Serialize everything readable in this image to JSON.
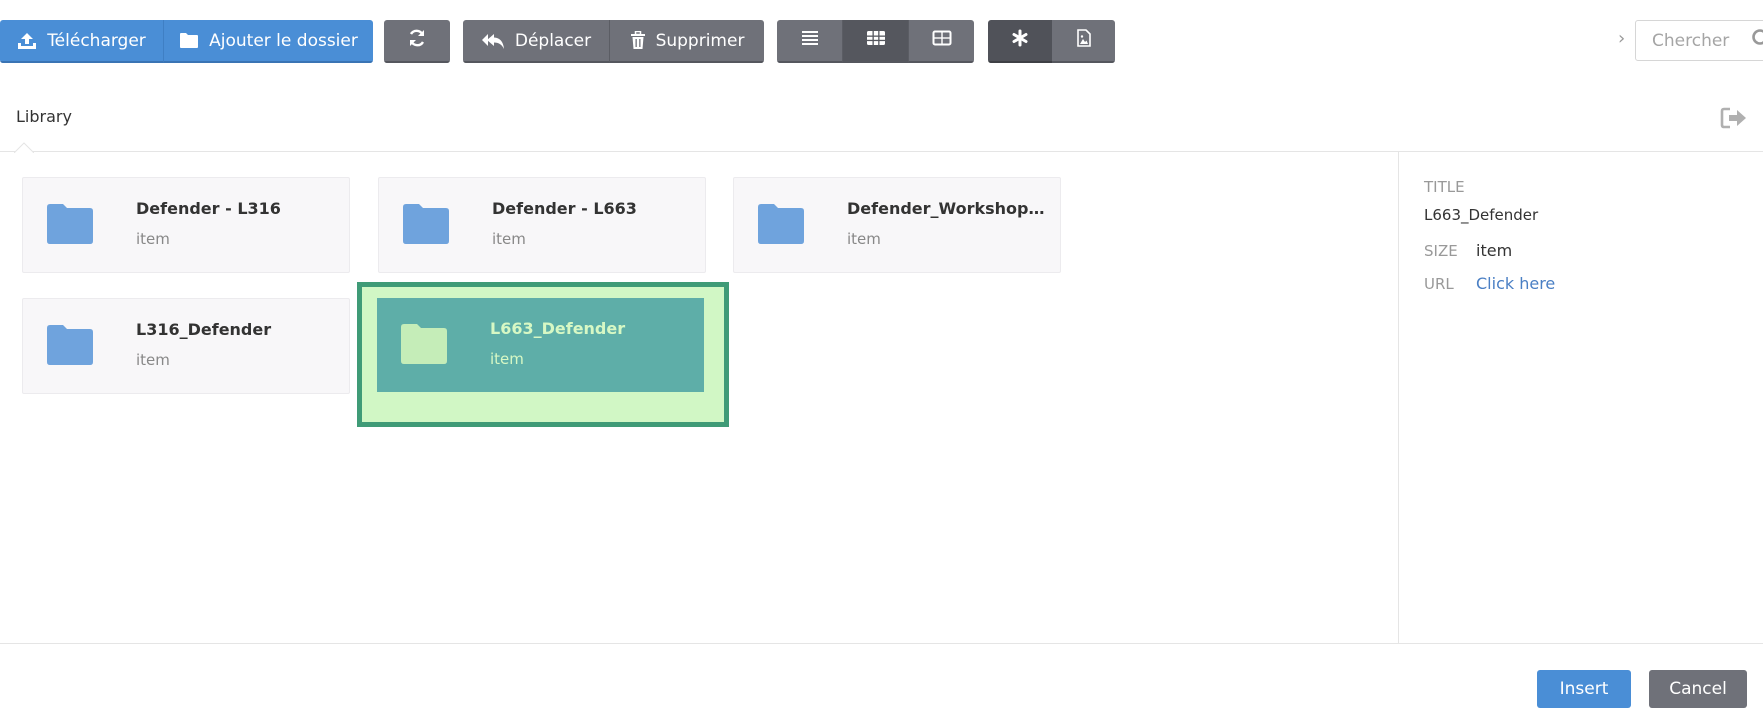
{
  "toolbar": {
    "upload_label": "Télécharger",
    "add_folder_label": "Ajouter le dossier",
    "move_label": "Déplacer",
    "delete_label": "Supprimer",
    "search_placeholder": "Chercher"
  },
  "breadcrumb": {
    "current": "Library"
  },
  "folders": [
    {
      "name": "Defender - L316",
      "sub": "item"
    },
    {
      "name": "Defender - L663",
      "sub": "item"
    },
    {
      "name": "Defender_Workshop_2...",
      "sub": "item"
    },
    {
      "name": "L316_Defender",
      "sub": "item"
    },
    {
      "name": "L663_Defender",
      "sub": "item",
      "selected": true
    }
  ],
  "details": {
    "title_label": "TITLE",
    "title_value": "L663_Defender",
    "size_label": "SIZE",
    "size_value": "item",
    "url_label": "URL",
    "url_value": "Click here"
  },
  "footer": {
    "insert_label": "Insert",
    "cancel_label": "Cancel"
  },
  "colors": {
    "primary": "#4a8ed6",
    "toolbar_gray": "#6f7179",
    "folder_icon": "#6fa3dd",
    "selected_fill": "#5eaea8",
    "selected_highlight": "#d1f7c5",
    "selected_border": "#3f9b77"
  }
}
